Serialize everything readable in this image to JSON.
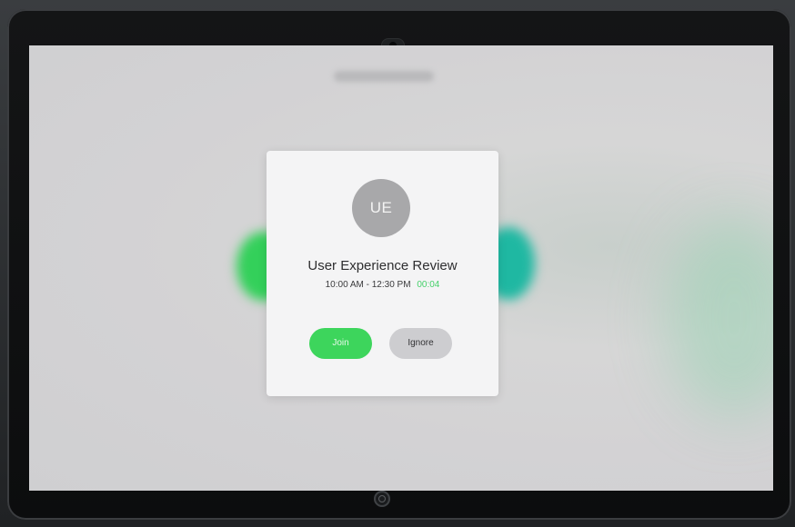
{
  "incoming_meeting": {
    "avatar_initials": "UE",
    "title": "User Experience Review",
    "time_range": "10:00 AM - 12:30 PM",
    "elapsed": "00:04"
  },
  "actions": {
    "join_label": "Join",
    "ignore_label": "Ignore"
  },
  "colors": {
    "join_green": "#3dd55c",
    "elapsed_green": "#45d06a",
    "ignore_gray": "#cdcdd0",
    "avatar_gray": "#a8a8aa",
    "dialog_bg": "#f4f4f5"
  },
  "icons": {
    "camera": "camera-icon",
    "home": "home-button-icon"
  }
}
